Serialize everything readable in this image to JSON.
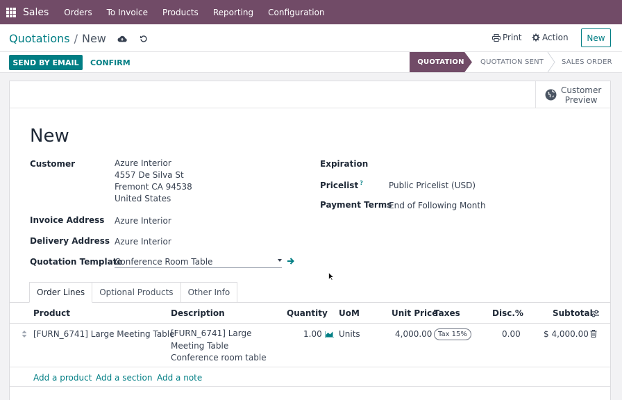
{
  "topnav": {
    "app_name": "Sales",
    "items": [
      "Orders",
      "To Invoice",
      "Products",
      "Reporting",
      "Configuration"
    ]
  },
  "breadcrumb": {
    "parent": "Quotations",
    "separator": "/",
    "current": "New"
  },
  "toolbar": {
    "print_label": "Print",
    "action_label": "Action",
    "new_label": "New"
  },
  "statusbar": {
    "send_label": "SEND BY EMAIL",
    "confirm_label": "CONFIRM",
    "stages": [
      "QUOTATION",
      "QUOTATION SENT",
      "SALES ORDER"
    ],
    "active_stage": "QUOTATION"
  },
  "button_box": {
    "preview_line1": "Customer",
    "preview_line2": "Preview"
  },
  "form": {
    "title": "New",
    "customer_label": "Customer",
    "customer_name": "Azure Interior",
    "customer_street": "4557 De Silva St",
    "customer_city": "Fremont CA 94538",
    "customer_country": "United States",
    "invoice_label": "Invoice Address",
    "invoice_value": "Azure Interior",
    "delivery_label": "Delivery Address",
    "delivery_value": "Azure Interior",
    "template_label": "Quotation Template",
    "template_value": "Conference Room Table",
    "expiration_label": "Expiration",
    "pricelist_label": "Pricelist",
    "pricelist_help": "?",
    "pricelist_value": "Public Pricelist (USD)",
    "terms_label": "Payment Terms",
    "terms_value": "End of Following Month"
  },
  "tabs": [
    "Order Lines",
    "Optional Products",
    "Other Info"
  ],
  "table": {
    "columns": [
      "Product",
      "Description",
      "Quantity",
      "UoM",
      "Unit Price",
      "Taxes",
      "Disc.%",
      "Subtotal"
    ],
    "rows": [
      {
        "product": "[FURN_6741] Large Meeting Table",
        "description_1": "[FURN_6741] Large",
        "description_2": "Meeting Table",
        "description_3": "Conference room table",
        "quantity": "1.00",
        "uom": "Units",
        "unit_price": "4,000.00",
        "tax": "Tax 15%",
        "discount": "0.00",
        "subtotal": "$ 4,000.00"
      }
    ],
    "add_product": "Add a product",
    "add_section": "Add a section",
    "add_note": "Add a note"
  },
  "colors": {
    "brand": "#714B67",
    "accent": "#017E84"
  },
  "icons": [
    "apps-grid-icon",
    "cloud-upload-icon",
    "undo-icon",
    "print-icon",
    "gear-icon",
    "globe-icon",
    "dropdown-caret-icon",
    "arrow-right-icon",
    "sort-handle-icon",
    "forecast-chart-icon",
    "trash-icon",
    "optional-columns-icon",
    "mouse-cursor-icon"
  ]
}
